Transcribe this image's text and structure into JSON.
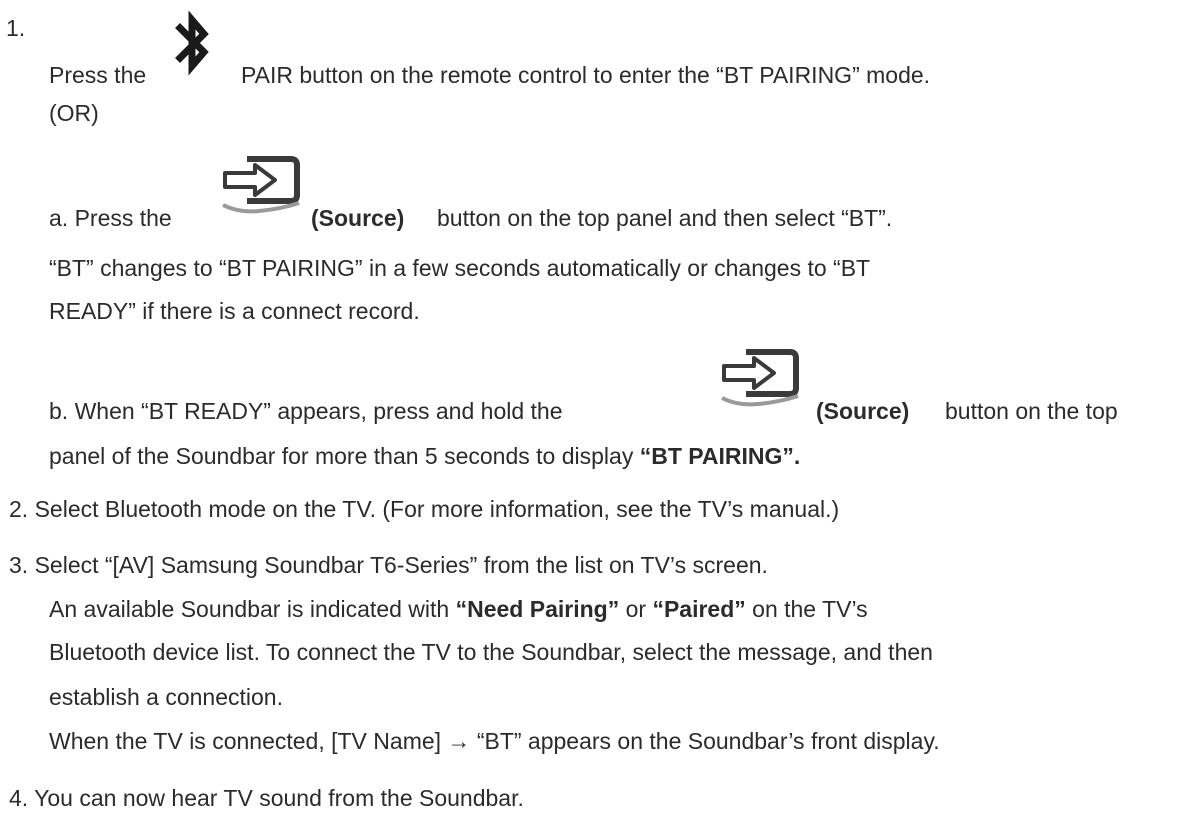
{
  "step1": {
    "num": "1.",
    "line1_pre": "Press the",
    "line1_post": "PAIR button on the remote control to enter the “BT PAIRING” mode.",
    "or": "(OR)",
    "a_pre": "a. Press the",
    "a_bold": "(Source)",
    "a_post": "button on the top panel and then select “BT”.",
    "a_line2": "“BT” changes to “BT PAIRING” in a few seconds automatically or changes to “BT",
    "a_line3": "READY” if there is a connect record.",
    "b_pre": "b. When “BT READY” appears, press and hold the",
    "b_bold": "(Source)",
    "b_post": "button on the top",
    "b_line2_pre": "panel of the Soundbar for more than 5 seconds to display",
    "b_line2_bold": "“BT PAIRING”."
  },
  "step2": {
    "text": "2. Select Bluetooth mode on the TV. (For more information, see the TV’s manual.)"
  },
  "step3": {
    "line1": "3. Select “[AV] Samsung Soundbar T6-Series” from the list on TV’s screen.",
    "line2_pre": "An available Soundbar is indicated with",
    "line2_bold1": "“Need Pairing”",
    "line2_mid": "or",
    "line2_bold2": "“Paired”",
    "line2_post": "on the TV’s",
    "line3": "Bluetooth device list. To connect the TV to the Soundbar, select the message, and then",
    "line4": "establish a connection.",
    "line5": "When the TV is connected, [TV Name] → “BT” appears on the Soundbar’s front display."
  },
  "step4": {
    "text": "4. You can now hear TV sound from the Soundbar."
  },
  "icons": {
    "bluetooth": "bluetooth-icon",
    "source": "source-icon"
  }
}
